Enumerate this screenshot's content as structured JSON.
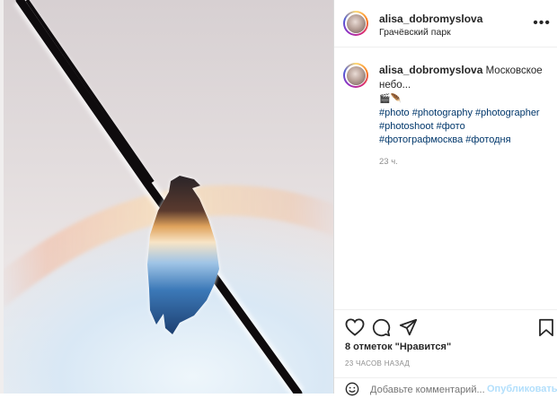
{
  "post": {
    "username": "alisa_dobromyslova",
    "location": "Грачёвский парк"
  },
  "caption": {
    "username": "alisa_dobromyslova",
    "text": "Московское небо...",
    "emoji": "🎬🪶",
    "hashtags_line1": "#photo #photography #photographer",
    "hashtags_line2": "#photoshoot #фото",
    "hashtags_line3": "#фотографмосква #фотодня",
    "time": "23 ч."
  },
  "actions": {
    "like_icon": "heart-icon",
    "comment_icon": "comment-icon",
    "share_icon": "share-icon",
    "save_icon": "bookmark-icon"
  },
  "likes_text": "8 отметок \"Нравится\"",
  "posted_ago": "23 ЧАСОВ НАЗАД",
  "comment_box": {
    "placeholder": "Добавьте комментарий...",
    "publish_label": "Опубликовать"
  }
}
